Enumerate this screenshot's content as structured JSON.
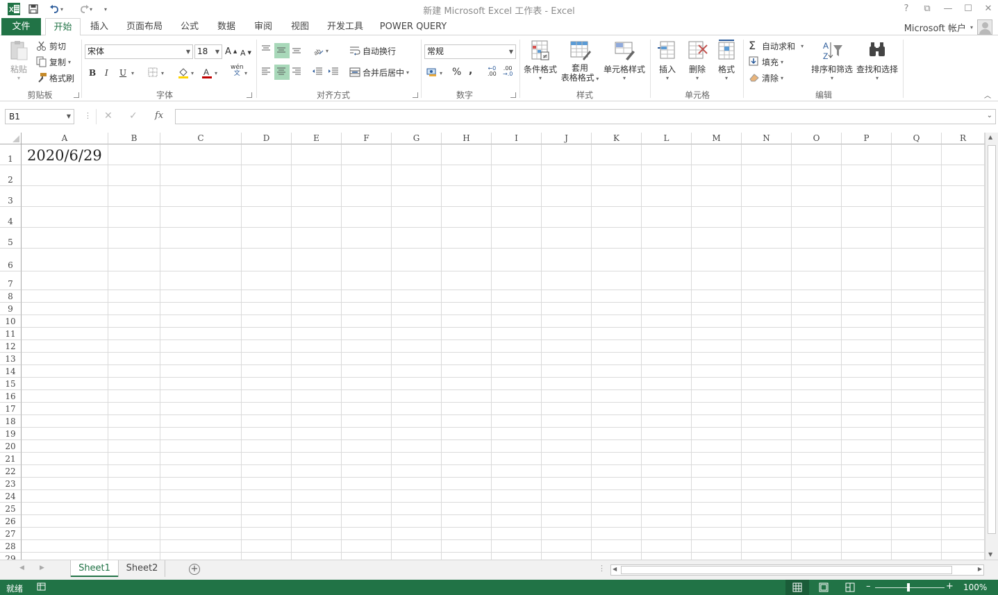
{
  "title": "新建 Microsoft Excel 工作表 - Excel",
  "window_controls": {
    "help": "?",
    "ribbon_display": "⧉",
    "minimize": "—",
    "maximize": "☐",
    "close": "✕"
  },
  "tabs": {
    "file": "文件",
    "home": "开始",
    "insert": "插入",
    "page_layout": "页面布局",
    "formulas": "公式",
    "data": "数据",
    "review": "审阅",
    "view": "视图",
    "developer": "开发工具",
    "power_query": "POWER QUERY"
  },
  "account": {
    "label": "Microsoft 帐户"
  },
  "ribbon": {
    "clipboard": {
      "label": "剪贴板",
      "paste": "粘贴",
      "cut": "剪切",
      "copy": "复制",
      "format_painter": "格式刷"
    },
    "font": {
      "label": "字体",
      "font_name": "宋体",
      "font_size": "18",
      "bold": "B",
      "italic": "I",
      "underline": "U",
      "phonetic": "wén"
    },
    "alignment": {
      "label": "对齐方式",
      "wrap_text": "自动换行",
      "merge_center": "合并后居中"
    },
    "number": {
      "label": "数字",
      "format": "常规",
      "percent": "%",
      "comma": ","
    },
    "styles": {
      "label": "样式",
      "conditional": "条件格式",
      "table_format_1": "套用",
      "table_format_2": "表格格式",
      "cell_styles": "单元格样式"
    },
    "cells": {
      "label": "单元格",
      "insert": "插入",
      "delete": "删除",
      "format": "格式"
    },
    "editing": {
      "label": "编辑",
      "autosum": "自动求和",
      "fill": "填充",
      "clear": "清除",
      "sort_filter": "排序和筛选",
      "find_select": "查找和选择"
    }
  },
  "formula_bar": {
    "name_box": "B1",
    "fx": "fx",
    "value": ""
  },
  "columns": [
    "A",
    "B",
    "C",
    "D",
    "E",
    "F",
    "G",
    "H",
    "I",
    "J",
    "K",
    "L",
    "M",
    "N",
    "O",
    "P",
    "Q",
    "R"
  ],
  "rows": [
    "1",
    "2",
    "3",
    "4",
    "5",
    "6",
    "7",
    "8",
    "9",
    "10",
    "11",
    "12",
    "13",
    "14",
    "15",
    "16",
    "17",
    "18",
    "19",
    "20",
    "21",
    "22",
    "23",
    "24",
    "25",
    "26",
    "27",
    "28",
    "29"
  ],
  "cells": {
    "A1": "2020/6/29"
  },
  "sheets": [
    "Sheet1",
    "Sheet2"
  ],
  "active_sheet": "Sheet1",
  "status": {
    "ready": "就绪",
    "zoom": "100%"
  },
  "colors": {
    "accent": "#217346"
  }
}
